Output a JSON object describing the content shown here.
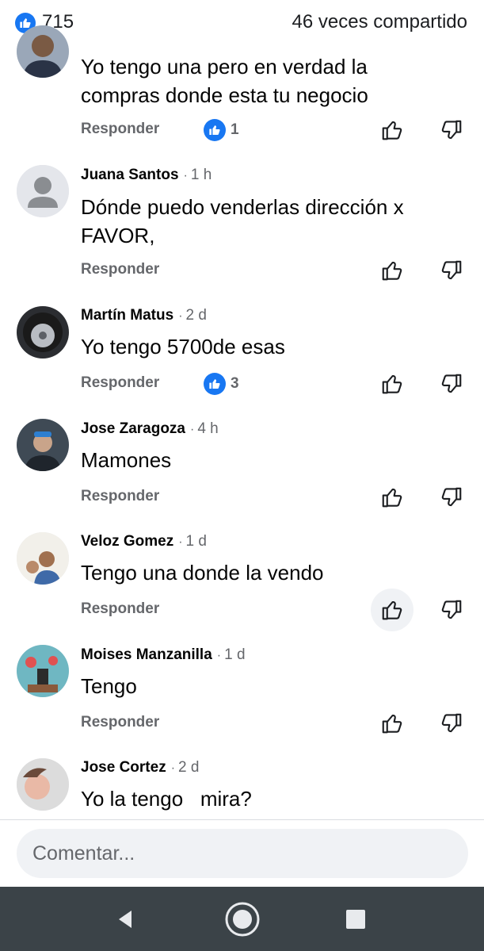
{
  "header": {
    "reaction_count": "715",
    "shares": "46 veces compartido",
    "like_color": "#1877f2"
  },
  "comments": [
    {
      "author": "",
      "time": "",
      "text": "Yo tengo una pero en verdad la compras donde esta tu negocio",
      "reply_label": "Responder",
      "reactions": "1",
      "avatar_icon": "man-portrait-avatar"
    },
    {
      "author": "Juana Santos",
      "time": "1 h",
      "text": "Dónde puedo venderlas dirección x FAVOR,",
      "reply_label": "Responder",
      "reactions": "",
      "avatar_icon": "default-person-avatar"
    },
    {
      "author": "Martín Matus",
      "time": "2 d",
      "text": "Yo tengo 5700de esas",
      "reply_label": "Responder",
      "reactions": "3",
      "avatar_icon": "wheel-avatar"
    },
    {
      "author": "Jose Zaragoza",
      "time": "4 h",
      "text": "Mamones",
      "reply_label": "Responder",
      "reactions": "",
      "avatar_icon": "man-cap-avatar"
    },
    {
      "author": "Veloz Gomez",
      "time": "1 d",
      "text": "Tengo una donde la vendo",
      "reply_label": "Responder",
      "reactions": "",
      "avatar_icon": "family-photo-avatar"
    },
    {
      "author": "Moises Manzanilla",
      "time": "1 d",
      "text": "Tengo",
      "reply_label": "Responder",
      "reactions": "",
      "avatar_icon": "flowers-avatar"
    },
    {
      "author": "Jose Cortez",
      "time": "2 d",
      "text": "Yo la tengo   mira?",
      "reply_label": "Responder",
      "reactions": "",
      "avatar_icon": "child-avatar"
    }
  ],
  "composer": {
    "placeholder": "Comentar..."
  },
  "nav": {
    "back_icon": "back-triangle-icon",
    "home_icon": "home-circle-icon",
    "recents_icon": "recents-square-icon"
  }
}
